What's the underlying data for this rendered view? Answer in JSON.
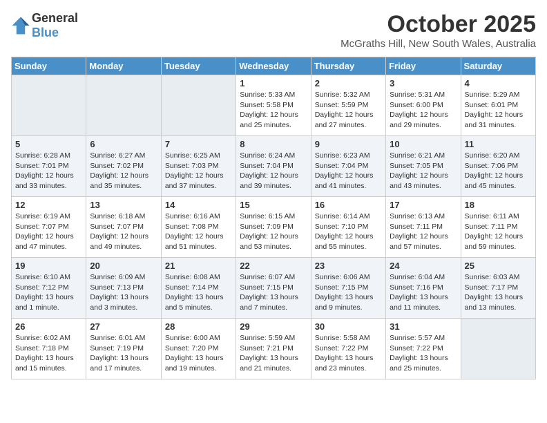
{
  "logo": {
    "line1": "General",
    "line2": "Blue"
  },
  "title": "October 2025",
  "location": "McGraths Hill, New South Wales, Australia",
  "days_header": [
    "Sunday",
    "Monday",
    "Tuesday",
    "Wednesday",
    "Thursday",
    "Friday",
    "Saturday"
  ],
  "weeks": [
    [
      {
        "num": "",
        "info": ""
      },
      {
        "num": "",
        "info": ""
      },
      {
        "num": "",
        "info": ""
      },
      {
        "num": "1",
        "info": "Sunrise: 5:33 AM\nSunset: 5:58 PM\nDaylight: 12 hours\nand 25 minutes."
      },
      {
        "num": "2",
        "info": "Sunrise: 5:32 AM\nSunset: 5:59 PM\nDaylight: 12 hours\nand 27 minutes."
      },
      {
        "num": "3",
        "info": "Sunrise: 5:31 AM\nSunset: 6:00 PM\nDaylight: 12 hours\nand 29 minutes."
      },
      {
        "num": "4",
        "info": "Sunrise: 5:29 AM\nSunset: 6:01 PM\nDaylight: 12 hours\nand 31 minutes."
      }
    ],
    [
      {
        "num": "5",
        "info": "Sunrise: 6:28 AM\nSunset: 7:01 PM\nDaylight: 12 hours\nand 33 minutes."
      },
      {
        "num": "6",
        "info": "Sunrise: 6:27 AM\nSunset: 7:02 PM\nDaylight: 12 hours\nand 35 minutes."
      },
      {
        "num": "7",
        "info": "Sunrise: 6:25 AM\nSunset: 7:03 PM\nDaylight: 12 hours\nand 37 minutes."
      },
      {
        "num": "8",
        "info": "Sunrise: 6:24 AM\nSunset: 7:04 PM\nDaylight: 12 hours\nand 39 minutes."
      },
      {
        "num": "9",
        "info": "Sunrise: 6:23 AM\nSunset: 7:04 PM\nDaylight: 12 hours\nand 41 minutes."
      },
      {
        "num": "10",
        "info": "Sunrise: 6:21 AM\nSunset: 7:05 PM\nDaylight: 12 hours\nand 43 minutes."
      },
      {
        "num": "11",
        "info": "Sunrise: 6:20 AM\nSunset: 7:06 PM\nDaylight: 12 hours\nand 45 minutes."
      }
    ],
    [
      {
        "num": "12",
        "info": "Sunrise: 6:19 AM\nSunset: 7:07 PM\nDaylight: 12 hours\nand 47 minutes."
      },
      {
        "num": "13",
        "info": "Sunrise: 6:18 AM\nSunset: 7:07 PM\nDaylight: 12 hours\nand 49 minutes."
      },
      {
        "num": "14",
        "info": "Sunrise: 6:16 AM\nSunset: 7:08 PM\nDaylight: 12 hours\nand 51 minutes."
      },
      {
        "num": "15",
        "info": "Sunrise: 6:15 AM\nSunset: 7:09 PM\nDaylight: 12 hours\nand 53 minutes."
      },
      {
        "num": "16",
        "info": "Sunrise: 6:14 AM\nSunset: 7:10 PM\nDaylight: 12 hours\nand 55 minutes."
      },
      {
        "num": "17",
        "info": "Sunrise: 6:13 AM\nSunset: 7:11 PM\nDaylight: 12 hours\nand 57 minutes."
      },
      {
        "num": "18",
        "info": "Sunrise: 6:11 AM\nSunset: 7:11 PM\nDaylight: 12 hours\nand 59 minutes."
      }
    ],
    [
      {
        "num": "19",
        "info": "Sunrise: 6:10 AM\nSunset: 7:12 PM\nDaylight: 13 hours\nand 1 minute."
      },
      {
        "num": "20",
        "info": "Sunrise: 6:09 AM\nSunset: 7:13 PM\nDaylight: 13 hours\nand 3 minutes."
      },
      {
        "num": "21",
        "info": "Sunrise: 6:08 AM\nSunset: 7:14 PM\nDaylight: 13 hours\nand 5 minutes."
      },
      {
        "num": "22",
        "info": "Sunrise: 6:07 AM\nSunset: 7:15 PM\nDaylight: 13 hours\nand 7 minutes."
      },
      {
        "num": "23",
        "info": "Sunrise: 6:06 AM\nSunset: 7:15 PM\nDaylight: 13 hours\nand 9 minutes."
      },
      {
        "num": "24",
        "info": "Sunrise: 6:04 AM\nSunset: 7:16 PM\nDaylight: 13 hours\nand 11 minutes."
      },
      {
        "num": "25",
        "info": "Sunrise: 6:03 AM\nSunset: 7:17 PM\nDaylight: 13 hours\nand 13 minutes."
      }
    ],
    [
      {
        "num": "26",
        "info": "Sunrise: 6:02 AM\nSunset: 7:18 PM\nDaylight: 13 hours\nand 15 minutes."
      },
      {
        "num": "27",
        "info": "Sunrise: 6:01 AM\nSunset: 7:19 PM\nDaylight: 13 hours\nand 17 minutes."
      },
      {
        "num": "28",
        "info": "Sunrise: 6:00 AM\nSunset: 7:20 PM\nDaylight: 13 hours\nand 19 minutes."
      },
      {
        "num": "29",
        "info": "Sunrise: 5:59 AM\nSunset: 7:21 PM\nDaylight: 13 hours\nand 21 minutes."
      },
      {
        "num": "30",
        "info": "Sunrise: 5:58 AM\nSunset: 7:22 PM\nDaylight: 13 hours\nand 23 minutes."
      },
      {
        "num": "31",
        "info": "Sunrise: 5:57 AM\nSunset: 7:22 PM\nDaylight: 13 hours\nand 25 minutes."
      },
      {
        "num": "",
        "info": ""
      }
    ]
  ]
}
